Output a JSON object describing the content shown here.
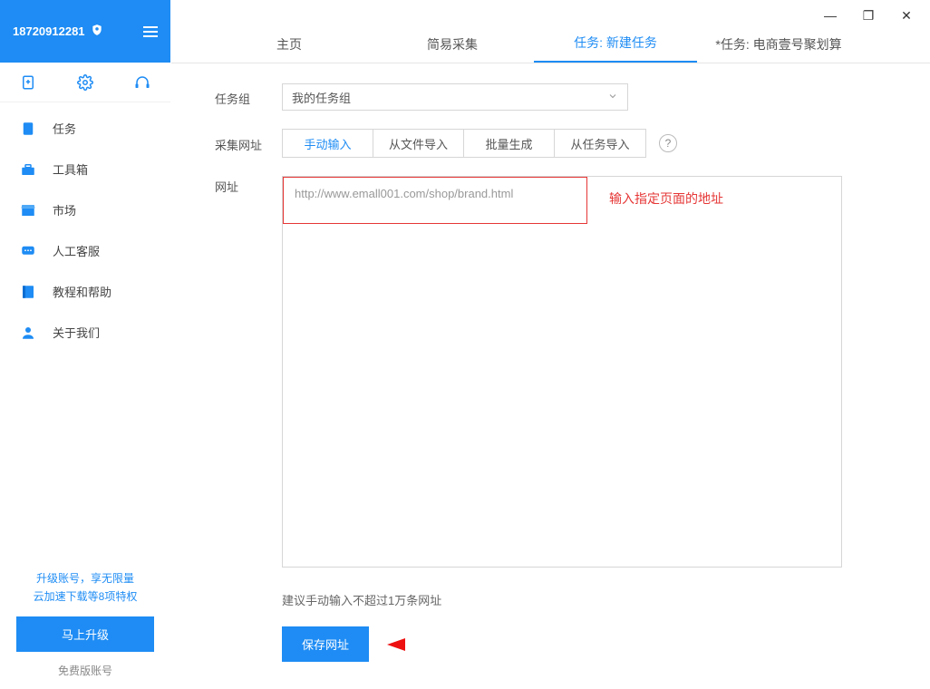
{
  "header": {
    "account_id": "18720912281"
  },
  "sidebar": {
    "items": [
      {
        "label": "任务"
      },
      {
        "label": "工具箱"
      },
      {
        "label": "市场"
      },
      {
        "label": "人工客服"
      },
      {
        "label": "教程和帮助"
      },
      {
        "label": "关于我们"
      }
    ],
    "promo_line1": "升级账号，享无限量",
    "promo_line2": "云加速下载等8项特权",
    "upgrade_label": "马上升级",
    "account_type": "免费版账号"
  },
  "tabs": [
    {
      "label": "主页"
    },
    {
      "label": "简易采集"
    },
    {
      "label": "任务: 新建任务"
    },
    {
      "label": "*任务: 电商壹号聚划算"
    }
  ],
  "form": {
    "group_label": "任务组",
    "group_value": "我的任务组",
    "collect_label": "采集网址",
    "segments": [
      {
        "label": "手动输入"
      },
      {
        "label": "从文件导入"
      },
      {
        "label": "批量生成"
      },
      {
        "label": "从任务导入"
      }
    ],
    "url_label": "网址",
    "url_value": "http://www.emall001.com/shop/brand.html",
    "annotation": "输入指定页面的地址",
    "hint": "建议手动输入不超过1万条网址",
    "save_label": "保存网址",
    "help_symbol": "?"
  },
  "window_controls": {
    "minimize": "—",
    "maximize": "❐",
    "close": "✕"
  }
}
